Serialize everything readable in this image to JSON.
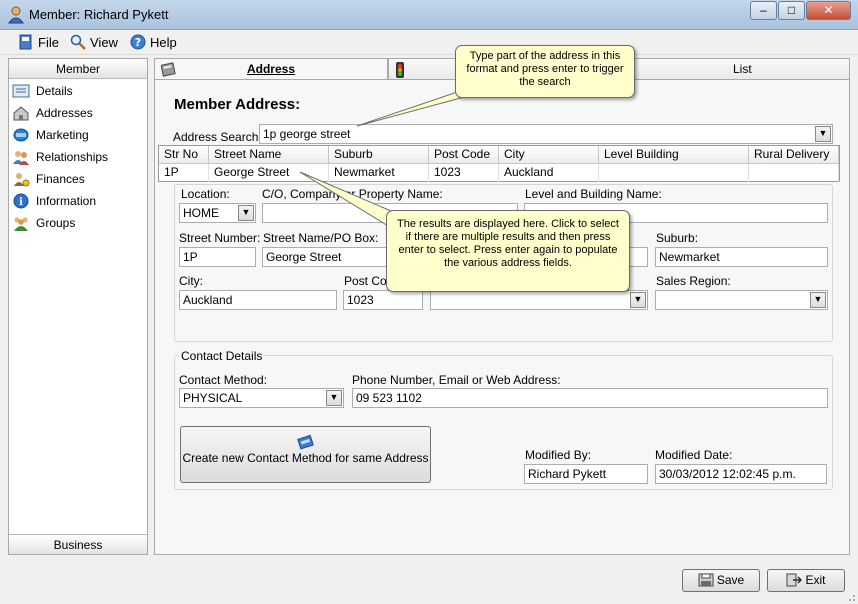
{
  "window": {
    "title": "Member: Richard Pykett"
  },
  "menu": {
    "file": "File",
    "view": "View",
    "help": "Help"
  },
  "sidebar": {
    "header": "Member",
    "footer": "Business",
    "items": [
      {
        "label": "Details",
        "icon": "details-icon"
      },
      {
        "label": "Addresses",
        "icon": "addresses-icon"
      },
      {
        "label": "Marketing",
        "icon": "marketing-icon"
      },
      {
        "label": "Relationships",
        "icon": "relationships-icon"
      },
      {
        "label": "Finances",
        "icon": "finances-icon"
      },
      {
        "label": "Information",
        "icon": "information-icon"
      },
      {
        "label": "Groups",
        "icon": "groups-icon"
      }
    ]
  },
  "tabs": {
    "address": "Address",
    "list": "List"
  },
  "form": {
    "heading": "Member Address:",
    "address_search_label": "Address Search:",
    "address_search_value": "1p george street",
    "results": {
      "columns": [
        "Str No",
        "Street Name",
        "Suburb",
        "Post Code",
        "City",
        "Level Building",
        "Rural Delivery"
      ],
      "rows": [
        [
          "1P",
          "George Street",
          "Newmarket",
          "1023",
          "Auckland",
          "",
          ""
        ]
      ]
    },
    "location_label": "Location:",
    "location_value": "HOME",
    "co_label": "C/O, Company or Property Name:",
    "co_value": "",
    "level_building_label": "Level and Building Name:",
    "level_building_value": "",
    "street_number_label": "Street Number:",
    "street_number_value": "1P",
    "street_name_label": "Street Name/PO Box:",
    "street_name_value": "George Street",
    "suburb_label": "Suburb:",
    "suburb_value": "Newmarket",
    "city_label": "City:",
    "city_value": "Auckland",
    "postcode_label": "Post Code:",
    "postcode_value": "1023",
    "sales_region_label": "Sales Region:",
    "sales_region_value": ""
  },
  "contact": {
    "legend": "Contact Details",
    "method_label": "Contact Method:",
    "method_value": "PHYSICAL",
    "phone_label": "Phone Number, Email or Web Address:",
    "phone_value": "09 523 1102",
    "create_button": "Create new Contact Method for same Address",
    "modified_by_label": "Modified By:",
    "modified_by_value": "Richard Pykett",
    "modified_date_label": "Modified Date:",
    "modified_date_value": "30/03/2012 12:02:45 p.m."
  },
  "callouts": {
    "top": "Type part of the address in this format and press enter to trigger the search",
    "middle": "The results are displayed here. Click to select if there are multiple results and then press enter to select. Press enter again to populate the various address fields."
  },
  "buttons": {
    "save": "Save",
    "exit": "Exit"
  }
}
